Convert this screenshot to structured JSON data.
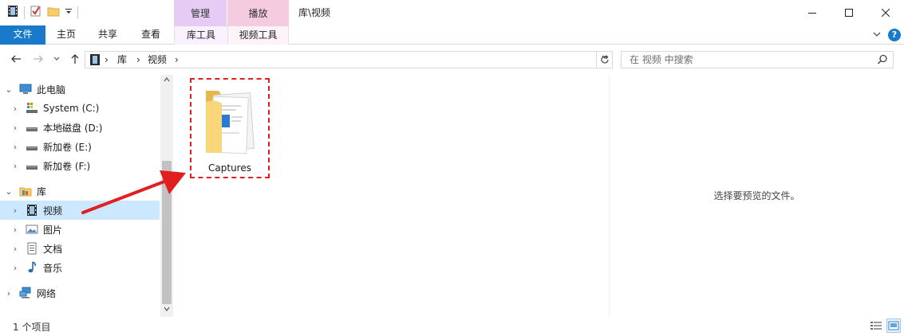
{
  "window": {
    "title": "库\\视频",
    "context_manage": "管理",
    "context_play": "播放"
  },
  "ribbon": {
    "tabs": [
      "文件",
      "主页",
      "共享",
      "查看",
      "库工具",
      "视频工具"
    ]
  },
  "address": {
    "crumbs": [
      "库",
      "视频"
    ]
  },
  "search": {
    "placeholder": "在 视频 中搜索"
  },
  "nav_tree": [
    {
      "label": "此电脑",
      "icon": "computer-icon",
      "level": 0,
      "expanded": true
    },
    {
      "label": "System (C:)",
      "icon": "system-drive-icon",
      "level": 1
    },
    {
      "label": "本地磁盘 (D:)",
      "icon": "drive-icon",
      "level": 1
    },
    {
      "label": "新加卷 (E:)",
      "icon": "drive-icon",
      "level": 1
    },
    {
      "label": "新加卷 (F:)",
      "icon": "drive-icon",
      "level": 1
    },
    {
      "label": "库",
      "icon": "library-icon",
      "level": 0,
      "expanded": true
    },
    {
      "label": "视频",
      "icon": "video-library-icon",
      "level": 1,
      "selected": true
    },
    {
      "label": "图片",
      "icon": "pictures-library-icon",
      "level": 1
    },
    {
      "label": "文档",
      "icon": "documents-library-icon",
      "level": 1
    },
    {
      "label": "音乐",
      "icon": "music-library-icon",
      "level": 1
    },
    {
      "label": "网络",
      "icon": "network-icon",
      "level": 0
    }
  ],
  "content": {
    "items": [
      {
        "name": "Captures",
        "icon": "folder-icon"
      }
    ]
  },
  "preview": {
    "message": "选择要预览的文件。"
  },
  "status": {
    "item_count": "1 个项目"
  },
  "colors": {
    "file_tab": "#1979ca",
    "manage_context": "#e6ccf5",
    "play_context": "#f5ccdf",
    "selection": "#cce8ff",
    "annotation_red": "#e02020"
  }
}
